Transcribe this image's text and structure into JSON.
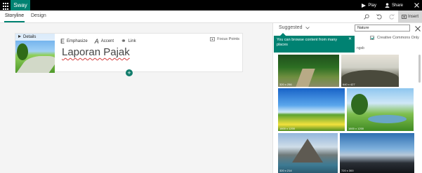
{
  "app": {
    "name": "Sway"
  },
  "titlebar": {
    "play_label": "Play",
    "share_label": "Share"
  },
  "tabs": [
    {
      "label": "Storyline",
      "active": true
    },
    {
      "label": "Design",
      "active": false
    }
  ],
  "toolbar": {
    "insert_label": "Insert"
  },
  "card": {
    "details_label": "Details",
    "format_items": [
      {
        "glyph": "E",
        "label": "Emphasize"
      },
      {
        "glyph": "A",
        "label": "Accent"
      },
      {
        "glyph": "⚭",
        "label": "Link"
      }
    ],
    "focus_points_label": "Focus Points",
    "title": "Laporan Pajak"
  },
  "panel": {
    "suggested_label": "Suggested",
    "search_value": "Nature",
    "creative_commons_label": "Creative Commons Only",
    "creative_commons_checked": true,
    "partial_label": "ngsb",
    "tooltip": "You can browse content from many places",
    "photos": [
      {
        "dim": "320 x 256"
      },
      {
        "dim": "640 x 427"
      },
      {
        "dim": "1600 x 1200"
      },
      {
        "dim": "1600 x 1200"
      },
      {
        "dim": "320 x 214"
      },
      {
        "dim": "720 x 300"
      }
    ]
  },
  "colors": {
    "accent": "#008272",
    "titlebar": "#000000"
  }
}
